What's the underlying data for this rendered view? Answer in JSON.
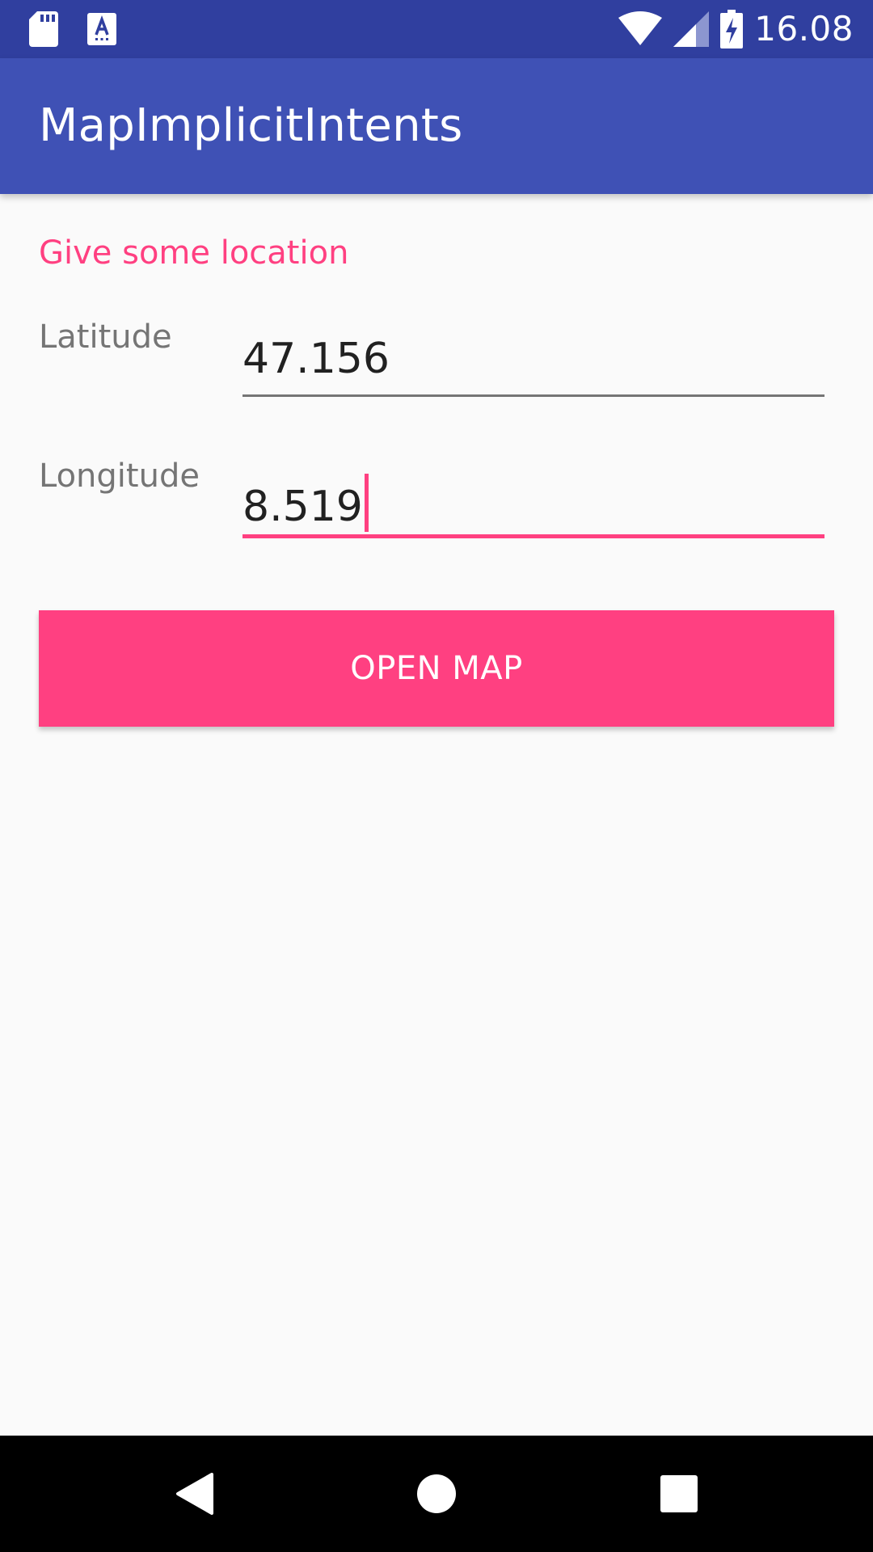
{
  "status_bar": {
    "time": "16.08",
    "left_icons": [
      "sd-card-icon",
      "keyboard-a-icon"
    ],
    "right_icons": [
      "wifi-icon",
      "cellular-signal-icon",
      "battery-charging-icon"
    ]
  },
  "app_bar": {
    "title": "MapImplicitIntents"
  },
  "form": {
    "prompt": "Give some location",
    "latitude_label": "Latitude",
    "latitude_value": "47.156",
    "longitude_label": "Longitude",
    "longitude_value": "8.519"
  },
  "actions": {
    "open_map_label": "OPEN MAP"
  },
  "nav_bar": {
    "icons": [
      "back-icon",
      "home-icon",
      "recents-icon"
    ]
  },
  "colors": {
    "primary_dark": "#303f9f",
    "primary": "#3f51b5",
    "accent": "#ff4081",
    "background": "#fafafa"
  }
}
